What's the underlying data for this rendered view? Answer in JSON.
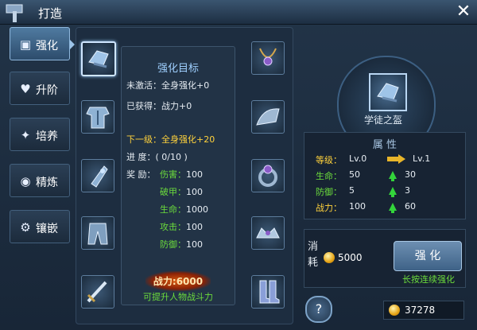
{
  "window": {
    "title": "打造",
    "close_label": "✕"
  },
  "tabs": [
    {
      "label": "强化",
      "icon": "enhance-icon",
      "active": true
    },
    {
      "label": "升阶",
      "icon": "heart-icon"
    },
    {
      "label": "培养",
      "icon": "sparkle-icon"
    },
    {
      "label": "精炼",
      "icon": "refine-icon"
    },
    {
      "label": "镶嵌",
      "icon": "gear-icon"
    }
  ],
  "equipment_slots": [
    {
      "slot": "helmet",
      "icon": "helmet-icon"
    },
    {
      "slot": "armor",
      "icon": "armor-icon"
    },
    {
      "slot": "bracer",
      "icon": "bracer-icon"
    },
    {
      "slot": "pants",
      "icon": "pants-icon"
    },
    {
      "slot": "weapon",
      "icon": "sword-icon"
    },
    {
      "slot": "necklace",
      "icon": "necklace-icon"
    },
    {
      "slot": "shoulder",
      "icon": "shoulder-icon"
    },
    {
      "slot": "ring",
      "icon": "ring-icon"
    },
    {
      "slot": "crown",
      "icon": "crown-icon"
    },
    {
      "slot": "boots",
      "icon": "boots-icon"
    }
  ],
  "target": {
    "title": "强化目标",
    "inactive": "未激活：全身强化+0",
    "obtained": "已获得：战力+0",
    "next_level_label": "下一级：",
    "next_level_value": "全身强化+20",
    "progress_label": "进 度：",
    "progress_value": "( 0/10 )",
    "reward_label": "奖 励：",
    "rewards": [
      {
        "name": "伤害：",
        "value": "100"
      },
      {
        "name": "破甲：",
        "value": "100"
      },
      {
        "name": "生命：",
        "value": "1000"
      },
      {
        "name": "攻击：",
        "value": "100"
      },
      {
        "name": "防御：",
        "value": "100"
      }
    ],
    "power_text": "战力:6000",
    "power_hint": "可提升人物战斗力"
  },
  "item": {
    "name": "学徒之盔",
    "icon": "helmet-icon"
  },
  "attributes": {
    "header": "属 性",
    "rows": [
      {
        "name": "等级：",
        "current": "Lv.0",
        "next": "Lv.1",
        "arrow": "gold-arrow"
      },
      {
        "name": "生命：",
        "current": "50",
        "next": "30",
        "arrow": "green-up-arrow"
      },
      {
        "name": "防御：",
        "current": "5",
        "next": "3",
        "arrow": "green-up-arrow"
      },
      {
        "name": "战力：",
        "current": "100",
        "next": "60",
        "arrow": "green-up-arrow"
      }
    ]
  },
  "cost": {
    "label": "消耗",
    "amount": "5000",
    "button": "强 化",
    "hint": "长按连续强化"
  },
  "help_label": "?",
  "gold_total": "37278",
  "colors": {
    "gold": "#ffd23c",
    "green": "#6cdc3c",
    "accent": "#9fd0ff"
  }
}
